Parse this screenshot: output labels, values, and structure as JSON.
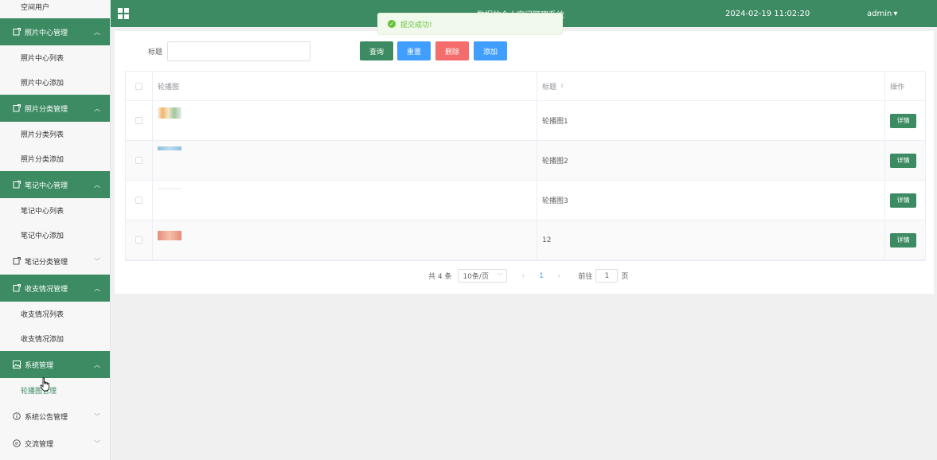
{
  "sidebar": {
    "top_item": "空间用户",
    "groups": [
      {
        "label": "照片中心管理",
        "expanded": true,
        "items": [
          "照片中心列表",
          "照片中心添加"
        ]
      },
      {
        "label": "照片分类管理",
        "expanded": true,
        "items": [
          "照片分类列表",
          "照片分类添加"
        ]
      },
      {
        "label": "笔记中心管理",
        "expanded": true,
        "items": [
          "笔记中心列表",
          "笔记中心添加"
        ]
      },
      {
        "label": "笔记分类管理",
        "expanded": false,
        "items": []
      },
      {
        "label": "收支情况管理",
        "expanded": true,
        "items": [
          "收支情况列表",
          "收支情况添加"
        ]
      },
      {
        "label": "系统管理",
        "expanded": true,
        "items": [
          "轮播图管理"
        ]
      },
      {
        "label": "系统公告管理",
        "expanded": false,
        "items": []
      },
      {
        "label": "交流管理",
        "expanded": false,
        "items": []
      }
    ],
    "active_item": "轮播图管理"
  },
  "topbar": {
    "title": "数据的个人空间管理系统",
    "datetime": "2024-02-19 11:02:20",
    "user": "admin",
    "user_caret": "▾"
  },
  "toast": {
    "message": "提交成功!",
    "icon": "check-circle-icon"
  },
  "search": {
    "label": "标题",
    "value": "",
    "placeholder": ""
  },
  "buttons": {
    "query": "查询",
    "reset": "重置",
    "delete": "删除",
    "add": "添加"
  },
  "table": {
    "headers": {
      "image": "轮播图",
      "title": "标题",
      "sort": "⇕",
      "actions": "操作"
    },
    "rows": [
      {
        "title": "轮播图1",
        "thumb_color": "#e9c9a0",
        "action": "详情"
      },
      {
        "title": "轮播图2",
        "thumb_color": "#8bbfe0",
        "action": "详情"
      },
      {
        "title": "轮播图3",
        "thumb_color": "#f3f3f3",
        "action": "详情"
      },
      {
        "title": "12",
        "thumb_color": "#e98b7e",
        "action": "详情"
      }
    ]
  },
  "pagination": {
    "total": "共 4 条",
    "page_size": "10条/页",
    "prev": "‹",
    "current": "1",
    "next": "›",
    "goto_label": "前往",
    "goto_value": "1",
    "page_unit": "页"
  },
  "colors": {
    "primary": "#3d8b63",
    "blue": "#409eff",
    "danger": "#f56c6c",
    "success": "#67c23a"
  }
}
